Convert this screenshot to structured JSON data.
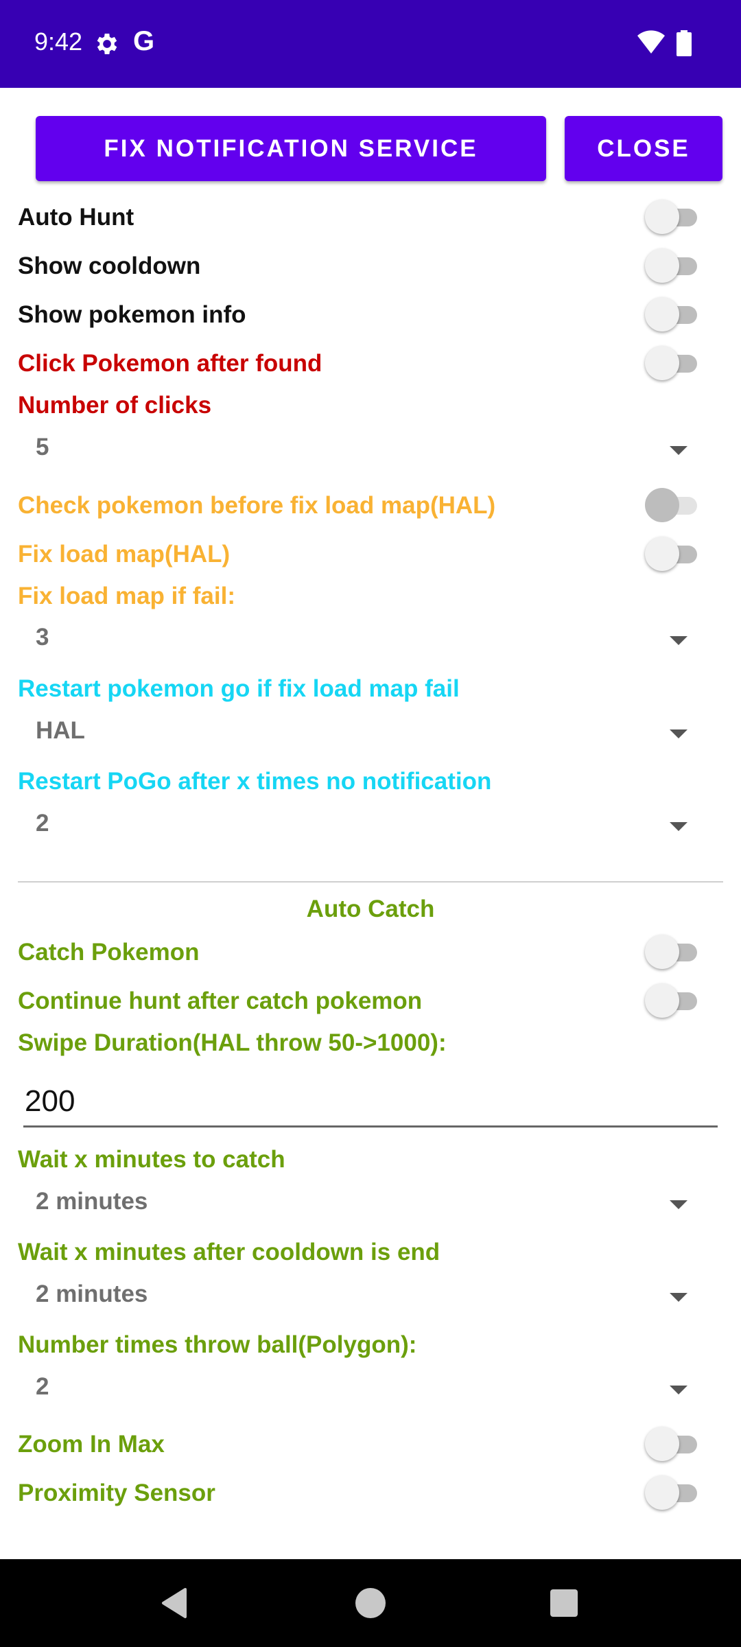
{
  "status_bar": {
    "time": "9:42",
    "icons": [
      "gear-icon",
      "google-g-icon",
      "wifi-icon",
      "battery-icon"
    ],
    "google_glyph": "G"
  },
  "toolbar": {
    "fix_label": "FIX NOTIFICATION SERVICE",
    "close_label": "CLOSE"
  },
  "settings": {
    "auto_hunt": {
      "label": "Auto Hunt",
      "checked": false
    },
    "show_cooldown": {
      "label": "Show cooldown",
      "checked": false
    },
    "show_pokemon_info": {
      "label": "Show pokemon info",
      "checked": false
    },
    "click_pokemon": {
      "label": "Click Pokemon after found",
      "checked": false
    },
    "number_of_clicks": {
      "label": "Number of clicks",
      "value": "5"
    },
    "check_pokemon_before_fix": {
      "label": "Check pokemon before fix load map(HAL)",
      "checked": false,
      "enabled": false
    },
    "fix_load_map": {
      "label": "Fix load map(HAL)",
      "checked": false
    },
    "fix_load_map_if_fail": {
      "label": "Fix load map if fail:",
      "value": "3"
    },
    "restart_pogo_if_fix_fail": {
      "label": "Restart pokemon go if fix load map fail",
      "value": "HAL"
    },
    "restart_pogo_no_notification": {
      "label": "Restart PoGo after x times no notification",
      "value": "2"
    }
  },
  "auto_catch": {
    "title": "Auto Catch",
    "catch_pokemon": {
      "label": "Catch Pokemon",
      "checked": false
    },
    "continue_hunt": {
      "label": "Continue hunt after catch pokemon",
      "checked": false
    },
    "swipe_duration": {
      "label": "Swipe Duration(HAL throw 50->1000):",
      "value": "200"
    },
    "wait_to_catch": {
      "label": "Wait x minutes to catch",
      "value": "2 minutes"
    },
    "wait_after_cooldown": {
      "label": "Wait x minutes after cooldown is end",
      "value": "2 minutes"
    },
    "throw_ball_times": {
      "label": "Number times throw ball(Polygon):",
      "value": "2"
    },
    "zoom_in_max": {
      "label": "Zoom In Max",
      "checked": false
    },
    "proximity_sensor": {
      "label": "Proximity Sensor",
      "checked": false
    }
  },
  "colors": {
    "status_bar": "#3700b3",
    "button": "#6200ee",
    "red_label": "#c80000",
    "orange_label": "#f9b233",
    "cyan_label": "#16d6f4",
    "green_label": "#6b9f0c"
  },
  "nav_bar": {
    "icons": [
      "back-icon",
      "home-icon",
      "recents-icon"
    ]
  }
}
